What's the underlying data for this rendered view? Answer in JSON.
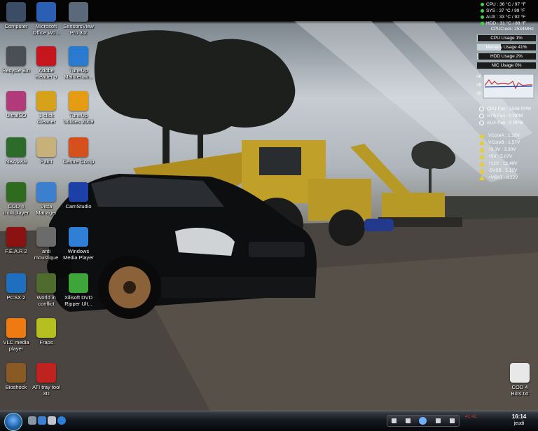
{
  "desktop": {
    "icons": [
      {
        "label": "Computer",
        "icon": "computer-icon",
        "color": "#3a4c66"
      },
      {
        "label": "Microsoft\nOffice Wo...",
        "icon": "word-icon",
        "color": "#2b5fb3"
      },
      {
        "label": "SensorsView\nPro 3.2",
        "icon": "sensors-icon",
        "color": "#5a6a7a"
      },
      {
        "label": "Recycle Bin",
        "icon": "recycle-bin-icon",
        "color": "#4a4f55"
      },
      {
        "label": "Adobe\nReader 9",
        "icon": "adobe-reader-icon",
        "color": "#c4161c"
      },
      {
        "label": "TuneUp\nMaintenan...",
        "icon": "tuneup-maintenance-icon",
        "color": "#2a7bd0"
      },
      {
        "label": "UltraISO",
        "icon": "ultraiso-icon",
        "color": "#b03a7a"
      },
      {
        "label": "1-click\nCleaner",
        "icon": "cleaner-icon",
        "color": "#d6a21a"
      },
      {
        "label": "TuneUp\nUtilities 2009",
        "icon": "tuneup-utilities-icon",
        "color": "#e59b12"
      },
      {
        "label": "NBA 2K9",
        "icon": "nba-icon",
        "color": "#2d6b2a"
      },
      {
        "label": "Paint",
        "icon": "paint-icon",
        "color": "#c8b07a"
      },
      {
        "label": "Centre Comp",
        "icon": "control-center-icon",
        "color": "#d6501e"
      },
      {
        "label": "COD 4\nmultiplayer",
        "icon": "cod4-icon",
        "color": "#2e6b1f"
      },
      {
        "label": "Vista\nManager",
        "icon": "vista-manager-icon",
        "color": "#3c7fcf"
      },
      {
        "label": "CamStudio",
        "icon": "camstudio-icon",
        "color": "#1d3fa8"
      },
      {
        "label": "F.E.A.R 2",
        "icon": "fear2-icon",
        "color": "#8c1111"
      },
      {
        "label": "anti\nmoustique",
        "icon": "anti-mosquito-icon",
        "color": "#6b6b6b"
      },
      {
        "label": "Windows\nMedia Player",
        "icon": "media-player-icon",
        "color": "#2f7fd6"
      },
      {
        "label": "PCSX 2",
        "icon": "pcsx2-icon",
        "color": "#1f6fc0"
      },
      {
        "label": "World in\nconflict",
        "icon": "world-in-conflict-icon",
        "color": "#4f6b2e"
      },
      {
        "label": "Xilisoft DVD\nRipper Ult...",
        "icon": "xilisoft-icon",
        "color": "#3da53a"
      },
      {
        "label": "VLC media\nplayer",
        "icon": "vlc-icon",
        "color": "#f07a12"
      },
      {
        "label": "Fraps",
        "icon": "fraps-icon",
        "color": "#b5c020"
      },
      {
        "label": "Bioshock",
        "icon": "bioshock-icon",
        "color": "#8a5a24"
      },
      {
        "label": "ATI tray tool\n3D",
        "icon": "ati-tray-icon",
        "color": "#c0231f"
      },
      {
        "label": "COD 4\nBots.txt",
        "icon": "text-file-icon",
        "color": "#e8e8e8"
      }
    ]
  },
  "gadget": {
    "temps": [
      {
        "label": "CPU :  36 °C / 97 °F",
        "color": "#3fd33f"
      },
      {
        "label": "SYS :  37 °C / 99 °F",
        "color": "#3fd33f"
      },
      {
        "label": "AUX :  33 °C / 92 °F",
        "color": "#3fd33f"
      },
      {
        "label": "HDD :  31 °C / 88 °F",
        "color": "#3fd33f"
      }
    ],
    "cpu_clock": "CPUClock: 2534MHz",
    "usage": [
      {
        "label": "CPU Usage 1%",
        "value": 0.01
      },
      {
        "label": "Memory Usage 41%",
        "value": 0.41
      },
      {
        "label": "HDD Usage 2%",
        "value": 0.02
      },
      {
        "label": "NIC Usage 0%",
        "value": 0.0
      }
    ],
    "graph_ticks": [
      "40",
      "35",
      "30"
    ],
    "fans": [
      "CPU Fan :  1508 RPM",
      "SYS Fan :  0 RPM",
      "AUX Fan :  0 RPM"
    ],
    "volts": [
      "VCoreA :  1.15V",
      "VCoreB :  1.57V",
      "+3.3V :  3.30V",
      "+5V :  5.07V",
      "+12V :  12.48V",
      "-5VSB :  5.12V",
      "+VBAT :  3.22V"
    ]
  },
  "taskbar": {
    "time": "16:14",
    "day": "jeudi",
    "tray_text": "41   42"
  }
}
